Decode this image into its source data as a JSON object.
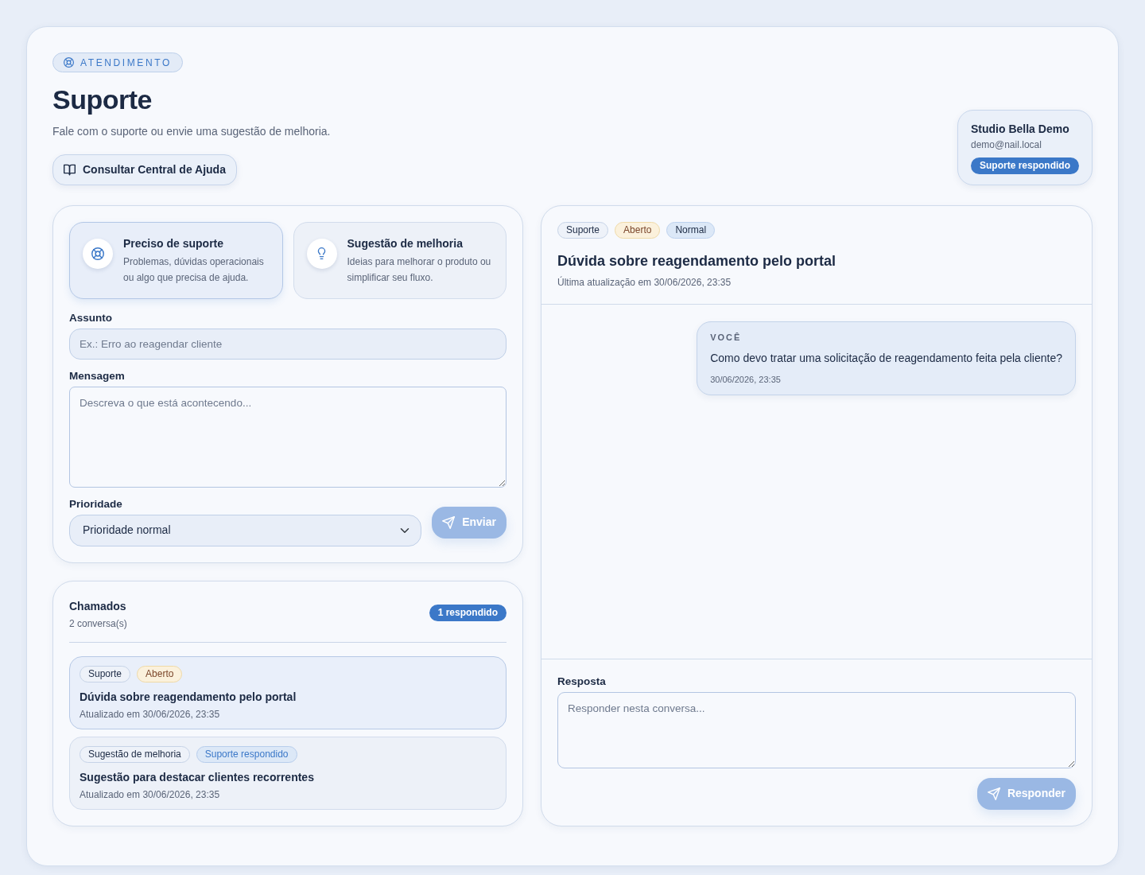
{
  "header": {
    "eyebrow": "ATENDIMENTO",
    "title": "Suporte",
    "subtitle": "Fale com o suporte ou envie uma sugestão de melhoria.",
    "help_button": "Consultar Central de Ajuda"
  },
  "account": {
    "name": "Studio Bella Demo",
    "email": "demo@nail.local",
    "badge": "Suporte respondido"
  },
  "new_request": {
    "types": [
      {
        "kind": "support",
        "title": "Preciso de suporte",
        "description": "Problemas, dúvidas operacionais ou algo que precisa de ajuda.",
        "selected": true
      },
      {
        "kind": "idea",
        "title": "Sugestão de melhoria",
        "description": "Ideias para melhorar o produto ou simplificar seu fluxo.",
        "selected": false
      }
    ],
    "subject": {
      "label": "Assunto",
      "placeholder": "Ex.: Erro ao reagendar cliente"
    },
    "message": {
      "label": "Mensagem",
      "placeholder": "Descreva o que está acontecendo..."
    },
    "priority": {
      "label": "Prioridade",
      "value": "Prioridade normal"
    },
    "submit": {
      "label": "Enviar",
      "disabled": true
    }
  },
  "tickets": {
    "title": "Chamados",
    "count": "2 conversa(s)",
    "badge": "1 respondido",
    "items": [
      {
        "tags": [
          {
            "label": "Suporte",
            "kind": "neutral"
          },
          {
            "label": "Aberto",
            "kind": "warning"
          }
        ],
        "title": "Dúvida sobre reagendamento pelo portal",
        "updated": "Atualizado em 30/06/2026, 23:35",
        "selected": true
      },
      {
        "tags": [
          {
            "label": "Sugestão de melhoria",
            "kind": "neutral"
          },
          {
            "label": "Suporte respondido",
            "kind": "accent"
          }
        ],
        "title": "Sugestão para destacar clientes recorrentes",
        "updated": "Atualizado em 30/06/2026, 23:35",
        "selected": false
      }
    ]
  },
  "conversation": {
    "tags": [
      {
        "label": "Suporte",
        "kind": "neutral"
      },
      {
        "label": "Aberto",
        "kind": "warning"
      },
      {
        "label": "Normal",
        "kind": "info"
      }
    ],
    "title": "Dúvida sobre reagendamento pelo portal",
    "updated": "Última atualização em 30/06/2026, 23:35",
    "messages": [
      {
        "kind": "sent",
        "author": "VOCÊ",
        "text": "Como devo tratar uma solicitação de reagendamento feita pela cliente?",
        "time": "30/06/2026, 23:35"
      }
    ],
    "reply": {
      "label": "Resposta",
      "placeholder": "Responder nesta conversa...",
      "button": {
        "label": "Responder",
        "disabled": true
      }
    }
  }
}
